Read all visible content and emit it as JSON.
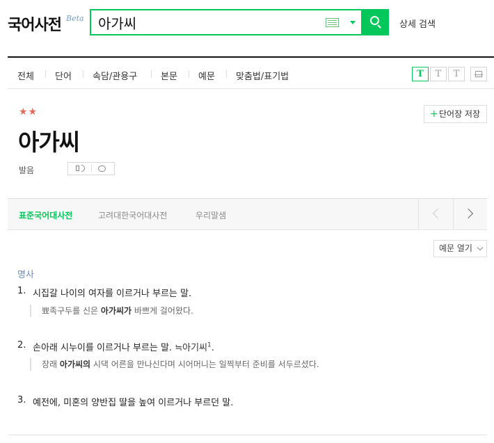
{
  "header": {
    "logo": "국어사전",
    "beta": "Beta",
    "search_value": "아가씨",
    "advanced_search": "상세 검색"
  },
  "categories": [
    "전체",
    "단어",
    "속담/관용구",
    "본문",
    "예문",
    "맞춤법/표기법"
  ],
  "font_buttons": [
    "T",
    "T",
    "T"
  ],
  "entry": {
    "stars": "★★",
    "save_button": "단어장 저장",
    "save_plus": "+",
    "word": "아가씨",
    "pron_label": "발음"
  },
  "tabs": [
    "표준국어대사전",
    "고려대한국어대사전",
    "우리말샘"
  ],
  "examples_toggle": "예문 열기",
  "definition": {
    "pos": "명사",
    "senses": [
      {
        "num": "1.",
        "text": "시집갈 나이의 여자를 이르거나 부르는 말.",
        "example": {
          "pre": "뾰족구두를 신은 ",
          "bold": "아가씨가",
          "post": " 바쁘게 걸어왔다."
        }
      },
      {
        "num": "2.",
        "text": "손아래 시누이를 이르거나 부르는 말. ",
        "ref_arrow": "≒",
        "ref_word": "아기씨",
        "ref_sup": "1",
        "ref_end": ".",
        "example": {
          "pre": "장래 ",
          "bold": "아가씨의",
          "post": " 시댁 어른을 만나신다며 시어머니는 일찍부터 준비를 서두르셨다."
        }
      },
      {
        "num": "3.",
        "text": "예전에, 미혼의 양반집 딸을 높여 이르거나 부르던 말."
      }
    ]
  },
  "colors": {
    "accent": "#03c75a",
    "star": "#e26a5a",
    "pos": "#6f8bb5"
  }
}
